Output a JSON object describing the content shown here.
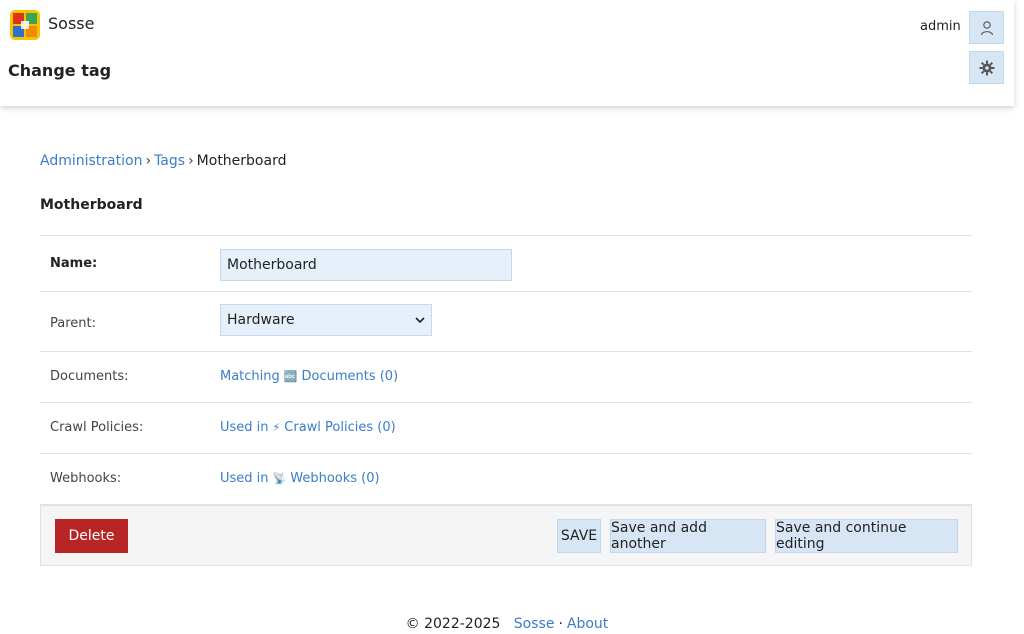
{
  "header": {
    "app_name": "Sosse",
    "page_title": "Change tag",
    "username": "admin",
    "user_icon": "user-icon",
    "settings_icon": "gear-icon"
  },
  "breadcrumb": {
    "items": [
      "Administration",
      "Tags"
    ],
    "current": "Motherboard",
    "separator": "›"
  },
  "object_title": "Motherboard",
  "form": {
    "name_label": "Name:",
    "name_value": "Motherboard",
    "parent_label": "Parent:",
    "parent_value": "Hardware",
    "documents_label": "Documents:",
    "documents_prefix": "Matching",
    "documents_emoji": "🔤",
    "documents_link": "Documents (0)",
    "crawl_label": "Crawl Policies:",
    "crawl_prefix": "Used in",
    "crawl_emoji": "⚡",
    "crawl_link": "Crawl Policies (0)",
    "webhooks_label": "Webhooks:",
    "webhooks_prefix": "Used in",
    "webhooks_emoji": "📡",
    "webhooks_link": "Webhooks (0)"
  },
  "actions": {
    "delete": "Delete",
    "save": "SAVE",
    "save_add": "Save and add another",
    "save_continue": "Save and continue editing"
  },
  "footer": {
    "copyright": "© 2022-2025",
    "link1": "Sosse",
    "separator": "·",
    "link2": "About"
  },
  "colors": {
    "accent": "#3a7dc9",
    "button_bg": "#d6e6f5",
    "delete_bg": "#b82525"
  }
}
